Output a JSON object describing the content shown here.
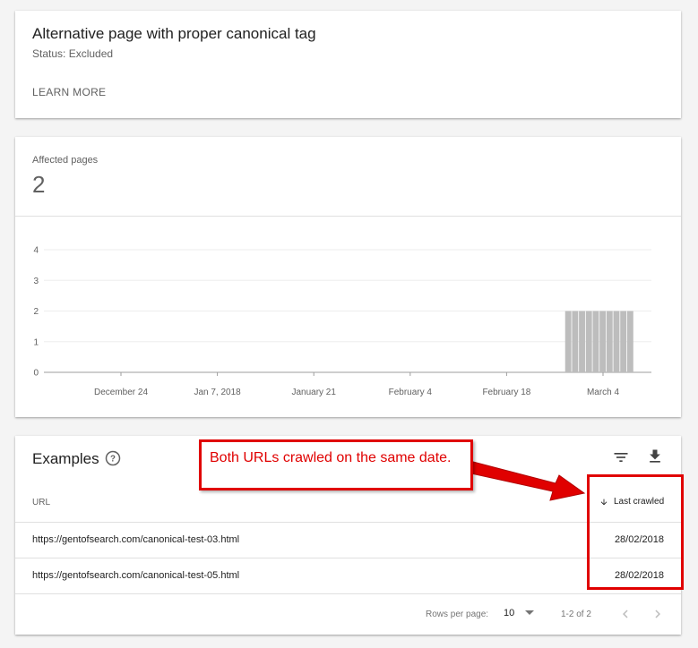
{
  "status_card": {
    "title": "Alternative page with proper canonical tag",
    "status": "Status: Excluded",
    "learn_more": "LEARN MORE"
  },
  "chart_card": {
    "affected_label": "Affected pages",
    "affected_count": "2"
  },
  "chart_data": {
    "type": "bar",
    "title": "",
    "xlabel": "",
    "ylabel": "",
    "ylim": [
      0,
      4
    ],
    "yticks": [
      "0",
      "1",
      "2",
      "3",
      "4"
    ],
    "xticks": [
      "December 24",
      "Jan 7, 2018",
      "January 21",
      "February 4",
      "February 18",
      "March 4"
    ],
    "grid": true,
    "series": [
      {
        "dates": [
          "2018-02-27",
          "2018-02-28",
          "2018-03-01",
          "2018-03-02",
          "2018-03-03",
          "2018-03-04",
          "2018-03-05",
          "2018-03-06",
          "2018-03-07",
          "2018-03-08"
        ],
        "values": [
          2,
          2,
          2,
          2,
          2,
          2,
          2,
          2,
          2,
          2
        ]
      }
    ],
    "bar_color": "#bdbdbd"
  },
  "examples_card": {
    "title": "Examples",
    "col_url": "URL",
    "col_last_crawled": "Last crawled",
    "rows": [
      {
        "url": "https://gentofsearch.com/canonical-test-03.html",
        "date": "28/02/2018"
      },
      {
        "url": "https://gentofsearch.com/canonical-test-05.html",
        "date": "28/02/2018"
      }
    ],
    "rows_per_page_label": "Rows per page:",
    "rows_per_page_value": "10",
    "range": "1-2 of 2"
  },
  "annotation": {
    "text": "Both URLs crawled on the same date.",
    "color": "#e00000"
  },
  "icons": {
    "help": "help-circle-icon",
    "filter": "filter-icon",
    "download": "download-icon",
    "sort": "arrow-down-icon",
    "dropdown": "caret-down-icon",
    "prev": "chevron-left-icon",
    "next": "chevron-right-icon"
  }
}
